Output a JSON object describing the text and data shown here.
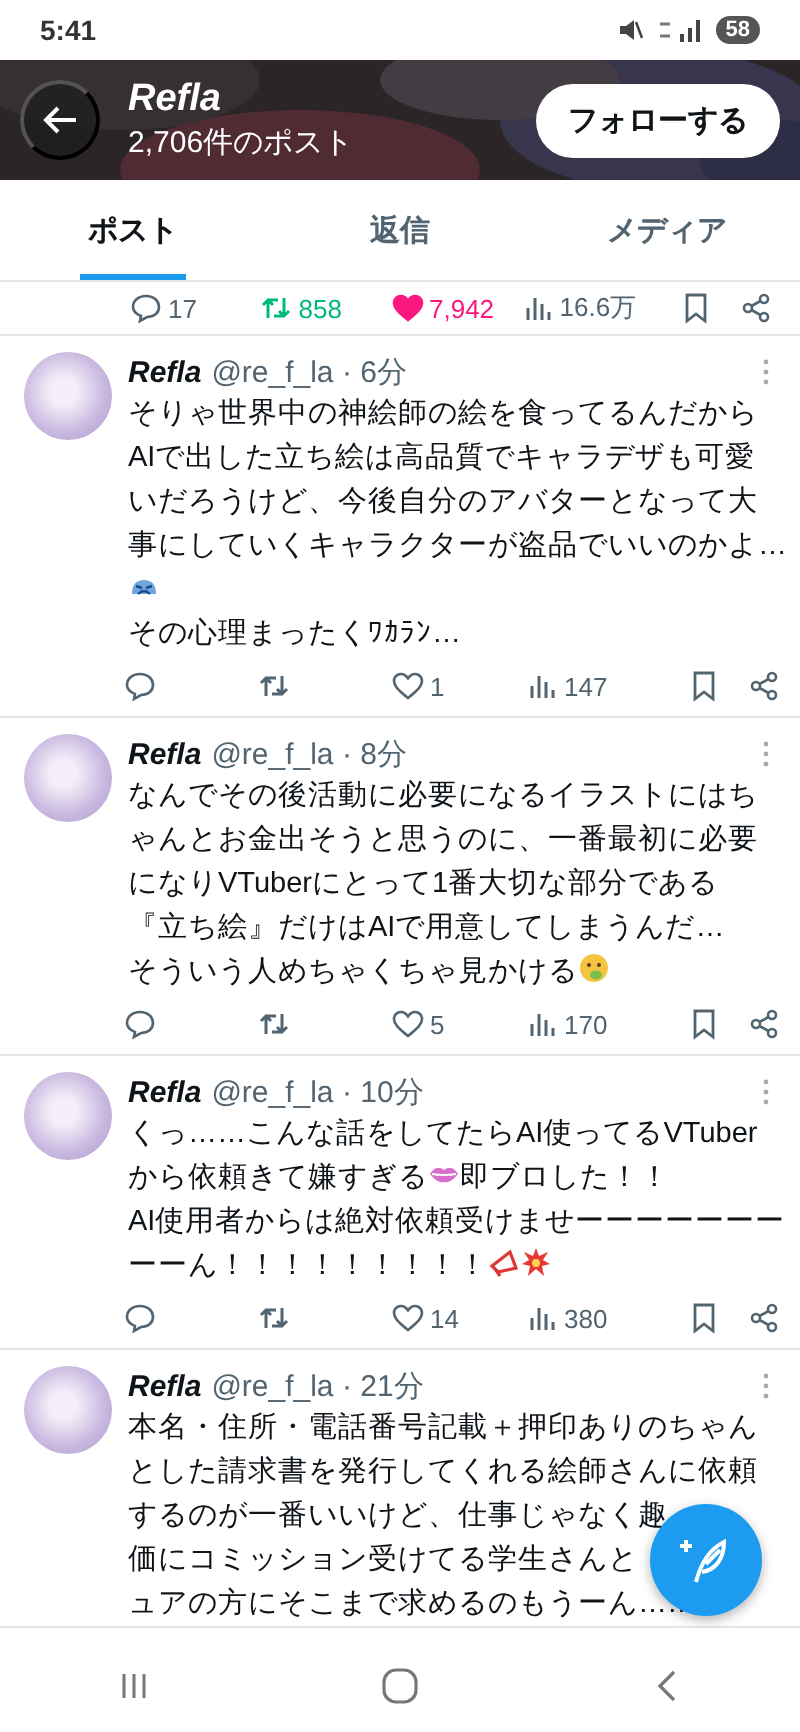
{
  "status_bar": {
    "time": "5:41",
    "battery": "58"
  },
  "header": {
    "title": "Refla",
    "subtitle": "2,706件のポスト",
    "follow_button": "フォローする"
  },
  "tabs": [
    {
      "label": "ポスト",
      "selected": true
    },
    {
      "label": "返信",
      "selected": false
    },
    {
      "label": "メディア",
      "selected": false
    }
  ],
  "top_post_actions": {
    "replies": "17",
    "reposts": "858",
    "reposted": true,
    "likes": "7,942",
    "liked": true,
    "views": "16.6万"
  },
  "posts": [
    {
      "name": "Refla",
      "meta": "@re_f_la · 6分",
      "lines": [
        [
          {
            "kind": "text",
            "text": "そりゃ世界中の神絵師の絵を食ってるんだから"
          }
        ],
        [
          {
            "kind": "text",
            "text": "AIで出した立ち絵は高品質でキャラデザも可愛"
          }
        ],
        [
          {
            "kind": "text",
            "text": "いだろうけど、今後自分のアバターとなって大"
          }
        ],
        [
          {
            "kind": "text",
            "text": "事にしていくキャラクターが盗品でいいのかよ…"
          }
        ],
        [
          {
            "kind": "sad-face"
          }
        ],
        [
          {
            "kind": "text",
            "text": "その心理まったくﾜｶﾗﾝ…"
          }
        ]
      ],
      "actions": {
        "reposted": false,
        "likes": "1",
        "liked": false,
        "views": "147"
      }
    },
    {
      "name": "Refla",
      "meta": "@re_f_la · 8分",
      "lines": [
        [
          {
            "kind": "text",
            "text": "なんでその後活動に必要になるイラストにはち"
          }
        ],
        [
          {
            "kind": "text",
            "text": "ゃんとお金出そうと思うのに、一番最初に必要"
          }
        ],
        [
          {
            "kind": "text",
            "text": "になりVTuberにとって1番大切な部分である"
          }
        ],
        [
          {
            "kind": "text",
            "text": "『立ち絵』だけはAIで用意してしまうんだ…"
          }
        ],
        [
          {
            "kind": "text",
            "text": "そういう人めちゃくちゃ見かける"
          },
          {
            "kind": "sick-face"
          }
        ]
      ],
      "actions": {
        "reposted": false,
        "likes": "5",
        "liked": false,
        "views": "170"
      }
    },
    {
      "name": "Refla",
      "meta": "@re_f_la · 10分",
      "lines": [
        [
          {
            "kind": "text",
            "text": "くっ……こんな話をしてたらAI使ってるVTuber"
          }
        ],
        [
          {
            "kind": "text",
            "text": "から依頼きて嫌すぎる"
          },
          {
            "kind": "lips"
          },
          {
            "kind": "text",
            "text": "即ブロした！！"
          }
        ],
        [
          {
            "kind": "text",
            "text": "AI使用者からは絶対依頼受けませーーーーーーー"
          }
        ],
        [
          {
            "kind": "text",
            "text": "ーーん！！！！！！！！！"
          },
          {
            "kind": "megaphone"
          },
          {
            "kind": "burst"
          }
        ]
      ],
      "actions": {
        "reposted": false,
        "likes": "14",
        "liked": false,
        "views": "380"
      }
    },
    {
      "name": "Refla",
      "meta": "@re_f_la · 21分",
      "lines": [
        [
          {
            "kind": "text",
            "text": "本名・住所・電話番号記載＋押印ありのちゃん"
          }
        ],
        [
          {
            "kind": "text",
            "text": "とした請求書を発行してくれる絵師さんに依頼"
          }
        ],
        [
          {
            "kind": "text",
            "text": "するのが一番いいけど、仕事じゃなく趣"
          }
        ],
        [
          {
            "kind": "text",
            "text": "価にコミッション受けてる学生さんと"
          }
        ],
        [
          {
            "kind": "text",
            "text": "ュアの方にそこまで求めるのもうーん……"
          }
        ]
      ]
    }
  ]
}
